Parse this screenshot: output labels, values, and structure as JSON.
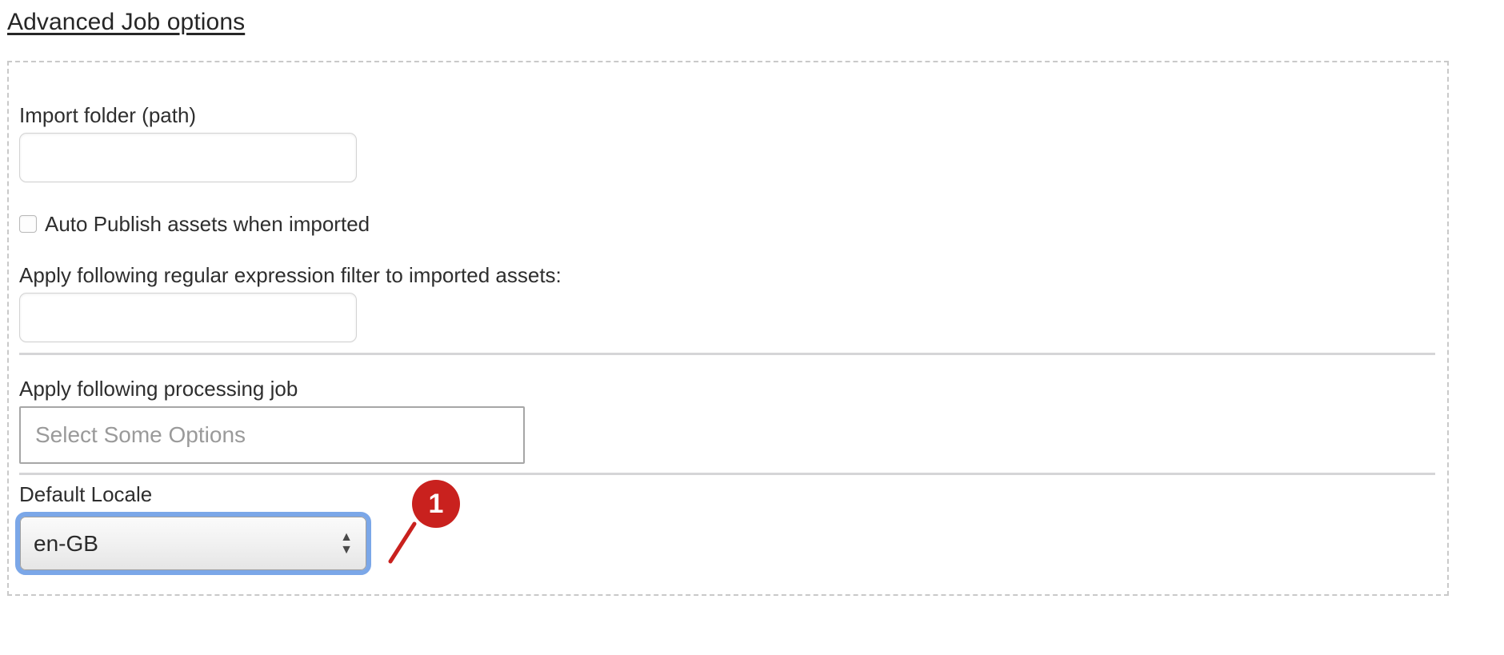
{
  "section": {
    "heading": "Advanced Job options"
  },
  "form": {
    "import_folder": {
      "label": "Import folder (path)",
      "value": "",
      "placeholder": ""
    },
    "auto_publish": {
      "label": "Auto Publish assets when imported",
      "checked": false
    },
    "regex_filter": {
      "label": "Apply following regular expression filter to imported assets:",
      "value": "",
      "placeholder": ""
    },
    "processing_job": {
      "label": "Apply following processing job",
      "placeholder": "Select Some Options",
      "value": ""
    },
    "default_locale": {
      "label": "Default Locale",
      "value": "en-GB",
      "up_arrow": "▲",
      "down_arrow": "▼"
    }
  },
  "annotation": {
    "badge_number": "1",
    "badge_color": "#c9211e",
    "target": "default-locale-select"
  },
  "colors": {
    "text": "#2e2e2e",
    "placeholder": "#9a9a9a",
    "panel_border": "#c9c9c9",
    "divider": "#d5d5d7",
    "focus_ring": "#7ba7e8",
    "annotation_red": "#c9211e"
  }
}
